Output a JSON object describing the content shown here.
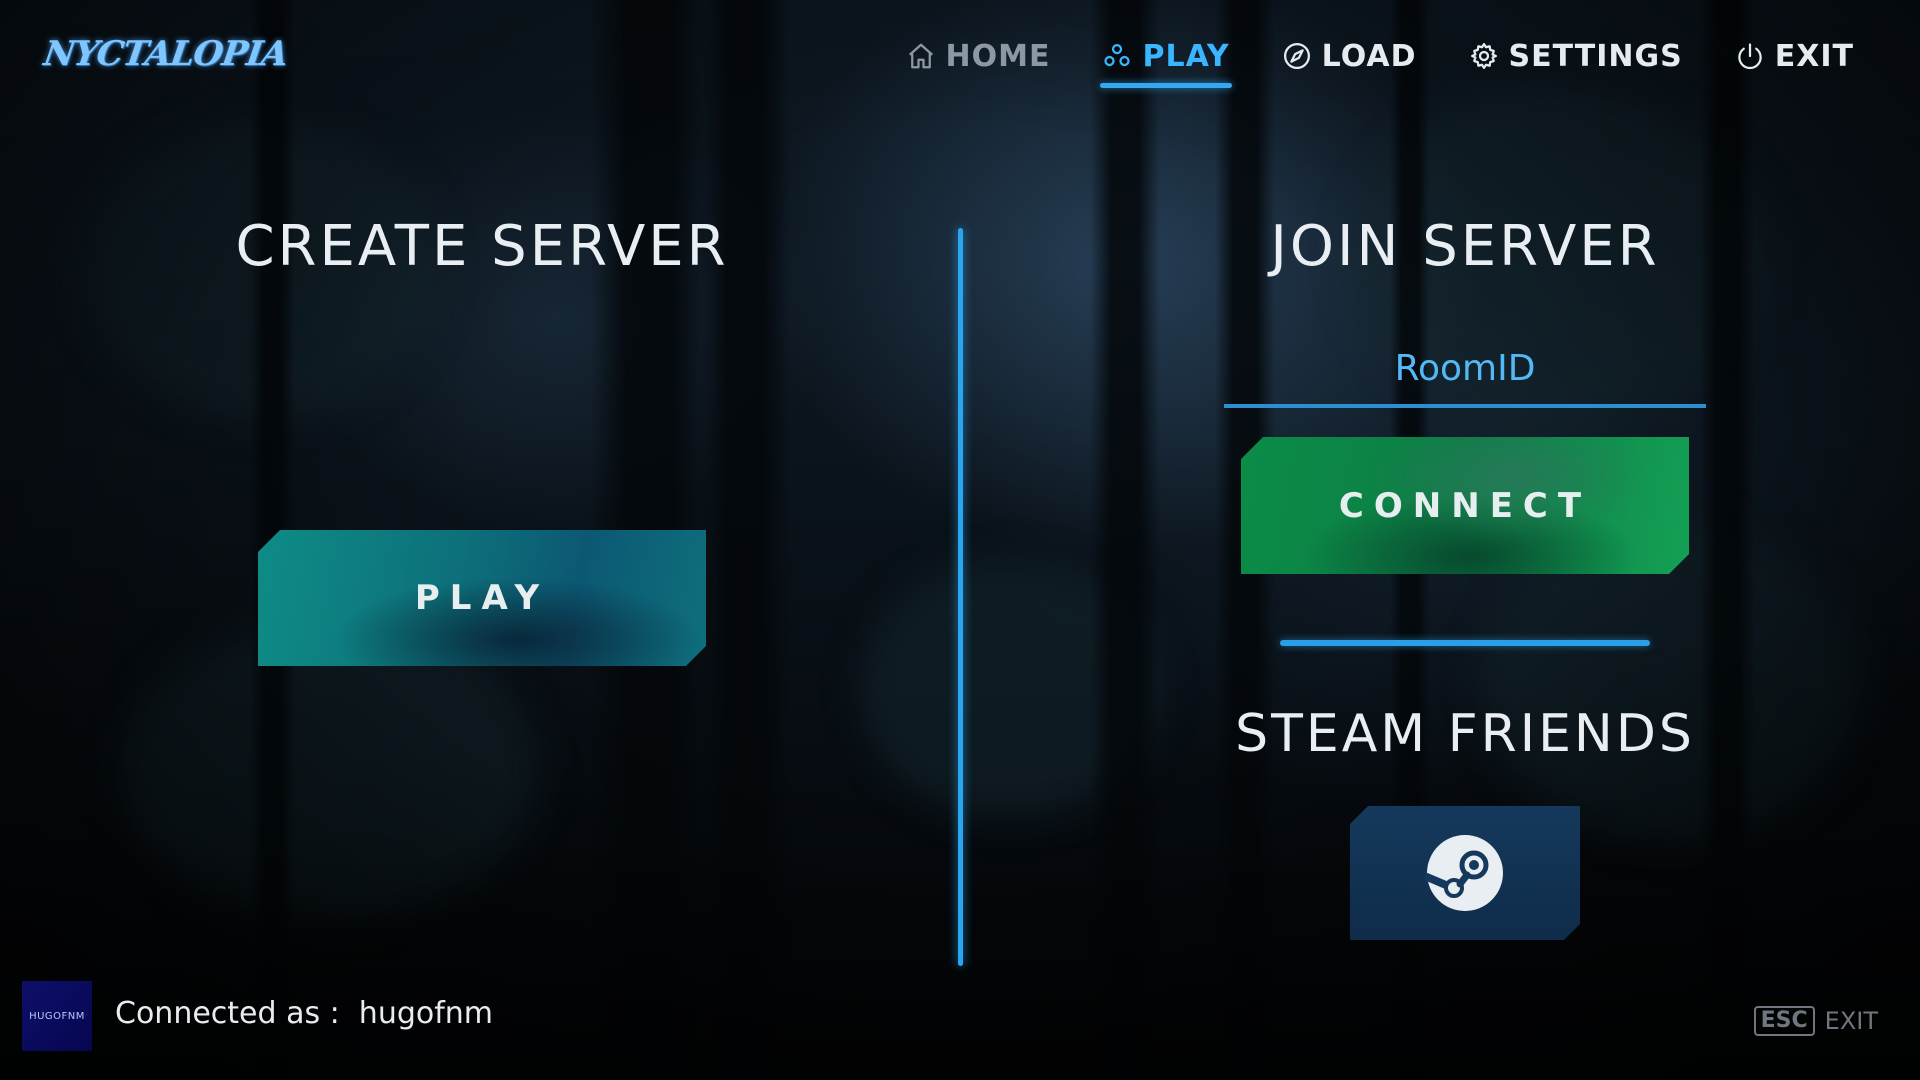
{
  "logo": {
    "text": "NYCTALOPIA"
  },
  "nav": {
    "items": [
      {
        "label": "HOME",
        "icon": "home-icon",
        "state": "dim"
      },
      {
        "label": "PLAY",
        "icon": "group-icon",
        "state": "active"
      },
      {
        "label": "LOAD",
        "icon": "compass-icon",
        "state": "normal"
      },
      {
        "label": "SETTINGS",
        "icon": "gear-icon",
        "state": "normal"
      },
      {
        "label": "EXIT",
        "icon": "power-icon",
        "state": "normal"
      }
    ]
  },
  "create": {
    "title": "CREATE SERVER",
    "play_label": "PLAY"
  },
  "join": {
    "title": "JOIN SERVER",
    "room_placeholder": "RoomID",
    "room_value": "",
    "connect_label": "CONNECT",
    "friends_title": "STEAM FRIENDS",
    "steam_icon": "steam-icon"
  },
  "footer": {
    "avatar_text": "HUGOFNM",
    "connected_text": "Connected as :  hugofnm",
    "esc_key": "ESC",
    "esc_label": "EXIT"
  },
  "colors": {
    "accent": "#35a8f2",
    "play_button": "#0e8c86",
    "connect_button": "#0d8a46",
    "steam_button": "#15395c"
  }
}
